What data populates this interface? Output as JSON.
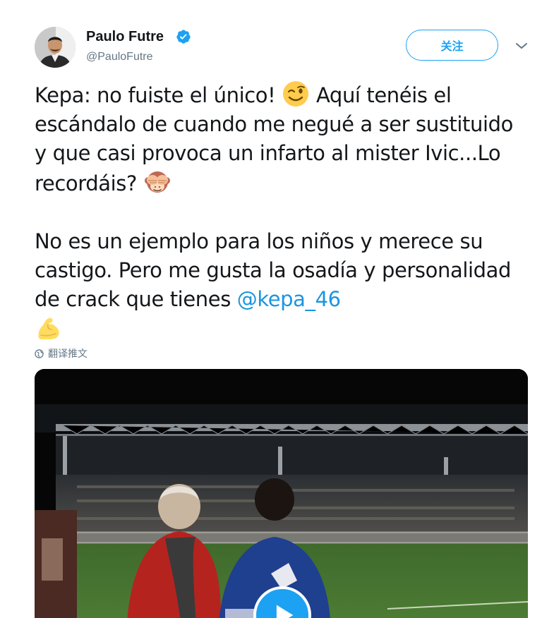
{
  "author": {
    "name": "Paulo Futre",
    "handle": "@PauloFutre",
    "verified": true
  },
  "header": {
    "follow_label": "关注",
    "more_icon": "chevron-down-icon"
  },
  "tweet": {
    "para1_a": "Kepa: no fuiste el único! ",
    "para1_emoji1": "winking-face-emoji",
    "para1_b": " Aquí tenéis el escándalo de cuando me negué a ser sustituido y que casi provoca un infarto al mister Ivic...Lo recordáis? ",
    "para1_emoji2": "see-no-evil-monkey-emoji",
    "para2_a": "No es un ejemplo para los niños y merece su castigo. Pero me gusta la osadía y personalidad de crack que tienes ",
    "mention": "@kepa_46",
    "para2_emoji": "flexed-biceps-emoji"
  },
  "translate": {
    "label": "翻译推文",
    "icon": "globe-icon"
  },
  "media": {
    "type": "video",
    "play_icon": "play-icon"
  },
  "colors": {
    "accent": "#1da1f2",
    "mention": "#1b95e0",
    "text": "#14171a",
    "muted": "#657786"
  }
}
